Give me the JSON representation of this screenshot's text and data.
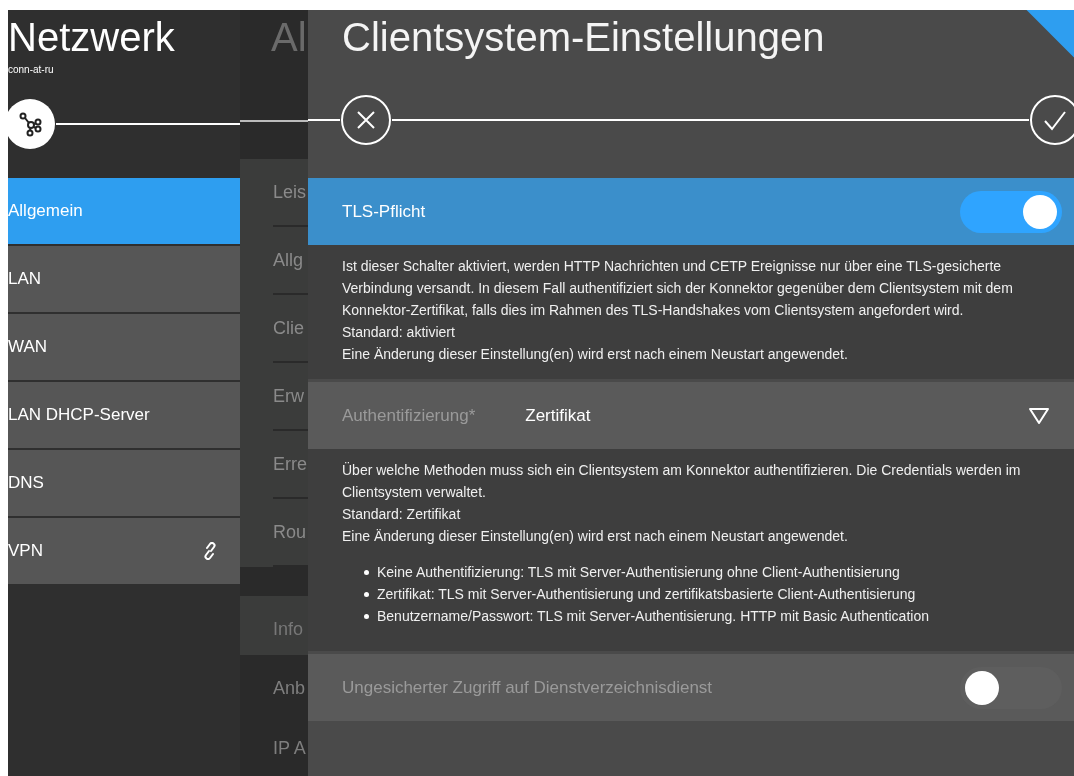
{
  "sidebar": {
    "title": "Netzwerk",
    "subtitle": "conn-at-ru",
    "items": [
      {
        "label": "Allgemein",
        "selected": true,
        "linked": false
      },
      {
        "label": "LAN",
        "selected": false,
        "linked": false
      },
      {
        "label": "WAN",
        "selected": false,
        "linked": false
      },
      {
        "label": "LAN DHCP-Server",
        "selected": false,
        "linked": false
      },
      {
        "label": "DNS",
        "selected": false,
        "linked": false
      },
      {
        "label": "VPN",
        "selected": false,
        "linked": true
      }
    ]
  },
  "middle": {
    "title": "Al",
    "items": [
      "Leis",
      "Allg",
      "Clie",
      "Erw",
      "Erre",
      "Rou"
    ],
    "info": "Info",
    "lower_items": [
      "Anb",
      "IP A"
    ]
  },
  "dialog": {
    "title": "Clientsystem-Einstellungen",
    "settings": [
      {
        "kind": "toggle",
        "label": "TLS-Pflicht",
        "selected": true,
        "on": true,
        "description": [
          "Ist dieser Schalter aktiviert, werden HTTP Nachrichten und CETP Ereignisse nur über eine TLS-gesicherte Verbindung versandt. In diesem Fall authentifiziert sich der Konnektor gegenüber dem Clientsystem mit dem Konnektor-Zertifikat, falls dies im Rahmen des TLS-Handshakes vom Clientsystem angefordert wird.",
          "Standard: aktiviert",
          "Eine Änderung dieser Einstellung(en) wird erst nach einem Neustart angewendet."
        ]
      },
      {
        "kind": "select",
        "label": "Authentifizierung*",
        "value": "Zertifikat",
        "selected": false,
        "description": [
          "Über welche Methoden muss sich ein Clientsystem am Konnektor authentifizieren. Die Credentials werden im Clientsystem verwaltet.",
          "Standard: Zertifikat",
          "Eine Änderung dieser Einstellung(en) wird erst nach einem Neustart angewendet."
        ],
        "bullets": [
          "Keine Authentifizierung: TLS mit Server-Authentisierung ohne Client-Authentisierung",
          "Zertifikat: TLS mit Server-Authentisierung und zertifikatsbasierte Client-Authentisierung",
          "Benutzername/Passwort: TLS mit Server-Authentisierung. HTTP mit Basic Authentication"
        ]
      },
      {
        "kind": "toggle",
        "label": "Ungesicherter Zugriff auf Dienstverzeichnisdienst",
        "selected": false,
        "on": false
      }
    ]
  }
}
